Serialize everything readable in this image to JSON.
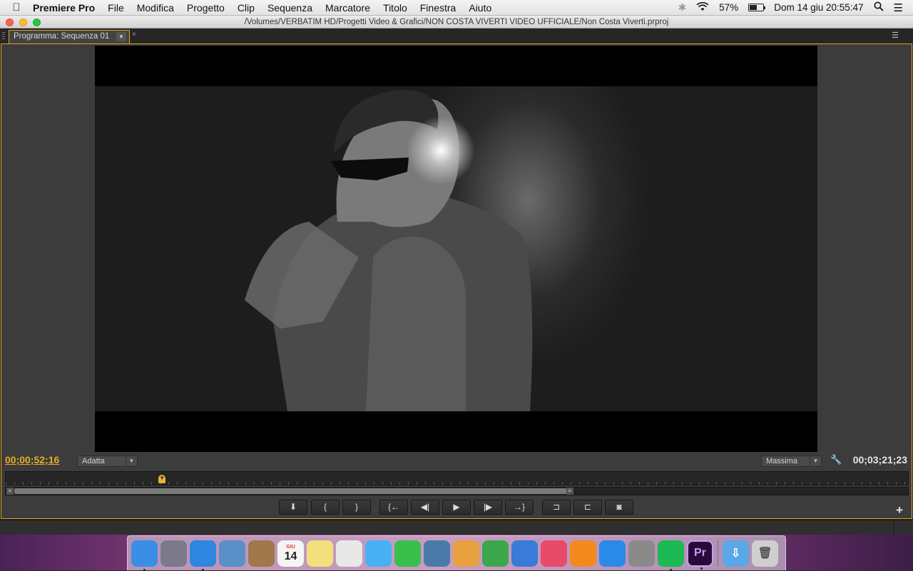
{
  "menubar": {
    "apple_icon": "apple-icon",
    "app_name": "Premiere Pro",
    "items": [
      "File",
      "Modifica",
      "Progetto",
      "Clip",
      "Sequenza",
      "Marcatore",
      "Titolo",
      "Finestra",
      "Aiuto"
    ],
    "battery_percent": "57%",
    "battery_level": 0.57,
    "datetime": "Dom 14 giu  20:55:47"
  },
  "window": {
    "title": "/Volumes/VERBATIM HD/Progetti Video & Grafici/NON COSTA VIVERTI VIDEO UFFICIALE/Non Costa Viverti.prproj"
  },
  "panel": {
    "tab_label": "Programma: Sequenza 01",
    "close_glyph": "×"
  },
  "monitor": {
    "current_timecode": "00;00;52;16",
    "duration_timecode": "00;03;21;23",
    "zoom_value": "Adatta",
    "quality_value": "Massima",
    "playhead_position": 0.173,
    "zoom_range_end": 0.62
  },
  "transport": [
    {
      "name": "add-marker-button",
      "glyph": "⬇"
    },
    {
      "name": "mark-in-button",
      "glyph": "{"
    },
    {
      "name": "mark-out-button",
      "glyph": "}"
    },
    {
      "name": "go-to-in-button",
      "glyph": "{←"
    },
    {
      "name": "step-back-button",
      "glyph": "◀|"
    },
    {
      "name": "play-button",
      "glyph": "▶"
    },
    {
      "name": "step-forward-button",
      "glyph": "|▶"
    },
    {
      "name": "go-to-out-button",
      "glyph": "→}"
    },
    {
      "name": "lift-button",
      "glyph": "⊐"
    },
    {
      "name": "extract-button",
      "glyph": "⊏"
    },
    {
      "name": "export-frame-button",
      "glyph": "◙"
    }
  ],
  "dock": {
    "apps": [
      {
        "name": "finder",
        "color": "#3a8ee6"
      },
      {
        "name": "launchpad",
        "color": "#7a7a8a"
      },
      {
        "name": "safari",
        "color": "#2e86de"
      },
      {
        "name": "preview",
        "color": "#5b8fc7"
      },
      {
        "name": "contacts",
        "color": "#a0784a"
      },
      {
        "name": "calendar",
        "color": "#f5f5f5"
      },
      {
        "name": "notes",
        "color": "#f3e07a"
      },
      {
        "name": "reminders",
        "color": "#e8e8e8"
      },
      {
        "name": "messages",
        "color": "#4ab0f5"
      },
      {
        "name": "facetime",
        "color": "#39c04a"
      },
      {
        "name": "iphoto",
        "color": "#4a7aa8"
      },
      {
        "name": "pages",
        "color": "#e8a040"
      },
      {
        "name": "numbers",
        "color": "#3aa84a"
      },
      {
        "name": "keynote",
        "color": "#3a7ad8"
      },
      {
        "name": "itunes",
        "color": "#e84a6a"
      },
      {
        "name": "ibooks",
        "color": "#f28a20"
      },
      {
        "name": "app-store",
        "color": "#2a8ae8"
      },
      {
        "name": "system-preferences",
        "color": "#8a8a8a"
      },
      {
        "name": "spotify",
        "color": "#1db954"
      },
      {
        "name": "premiere-pro",
        "color": "#2a0a3a"
      }
    ],
    "calendar_month": "GIU",
    "calendar_day": "14",
    "premiere_label": "Pr",
    "downloads_color": "#5aa8e8",
    "trash_color": "#cfcfcf"
  }
}
